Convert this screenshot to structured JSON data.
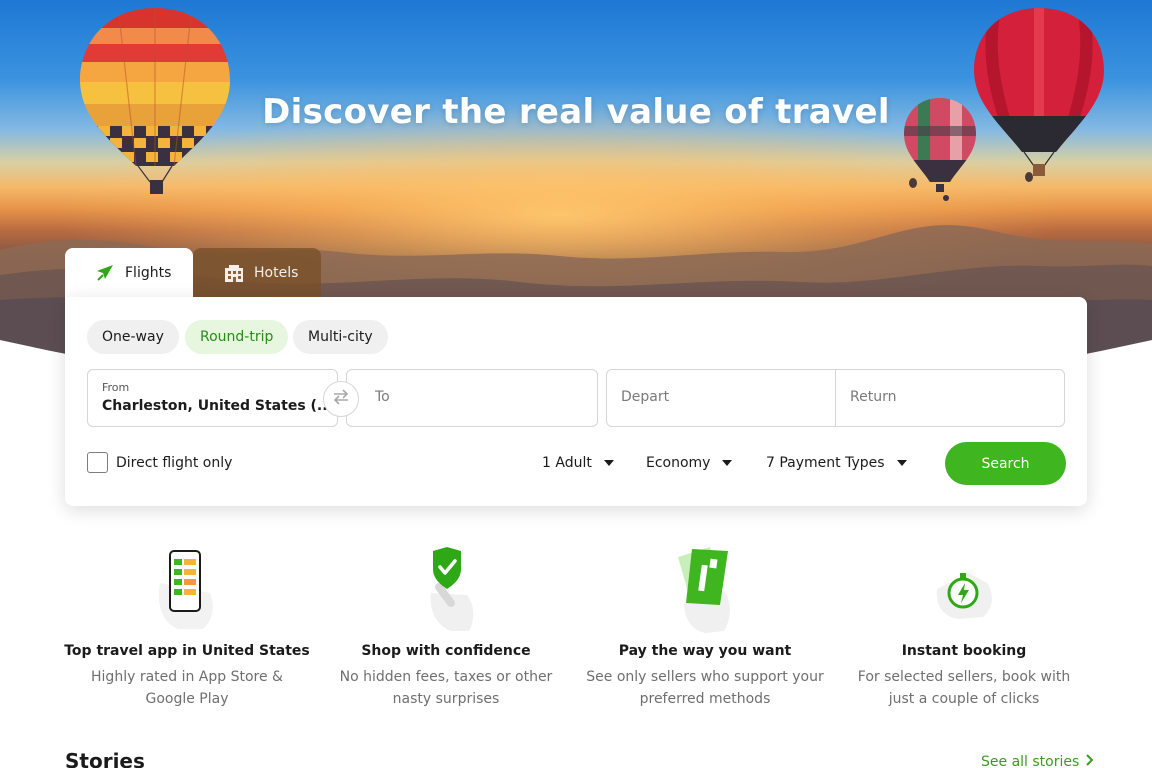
{
  "hero": {
    "title": "Discover the real value of travel"
  },
  "tabs": [
    {
      "label": "Flights",
      "icon": "plane-icon",
      "active": true
    },
    {
      "label": "Hotels",
      "icon": "building-icon",
      "active": false
    }
  ],
  "trip_types": [
    {
      "label": "One-way",
      "selected": false
    },
    {
      "label": "Round-trip",
      "selected": true
    },
    {
      "label": "Multi-city",
      "selected": false
    }
  ],
  "fields": {
    "from": {
      "label": "From",
      "value": "Charleston, United States (..."
    },
    "to": {
      "placeholder": "To"
    },
    "depart": {
      "placeholder": "Depart"
    },
    "return": {
      "placeholder": "Return"
    }
  },
  "options": {
    "direct_label": "Direct flight only",
    "direct_checked": false,
    "passengers": "1 Adult",
    "cabin": "Economy",
    "payment": "7 Payment Types",
    "search_label": "Search"
  },
  "features": [
    {
      "title": "Top travel app in United States",
      "desc": "Highly rated in App Store & Google Play",
      "icon": "phone-app-icon"
    },
    {
      "title": "Shop with confidence",
      "desc": "No hidden fees, taxes or other nasty surprises",
      "icon": "shield-check-icon"
    },
    {
      "title": "Pay the way you want",
      "desc": "See only sellers who support your preferred methods",
      "icon": "payment-card-icon"
    },
    {
      "title": "Instant booking",
      "desc": "For selected sellers, book with just a couple of clicks",
      "icon": "stopwatch-bolt-icon"
    }
  ],
  "stories": {
    "title": "Stories",
    "see_all": "See all stories",
    "see_all_icon": "chevron-right-icon"
  },
  "colors": {
    "brand_green": "#3fb51f",
    "link_green": "#3a9a22",
    "selected_pill_bg": "#e6f6df"
  }
}
